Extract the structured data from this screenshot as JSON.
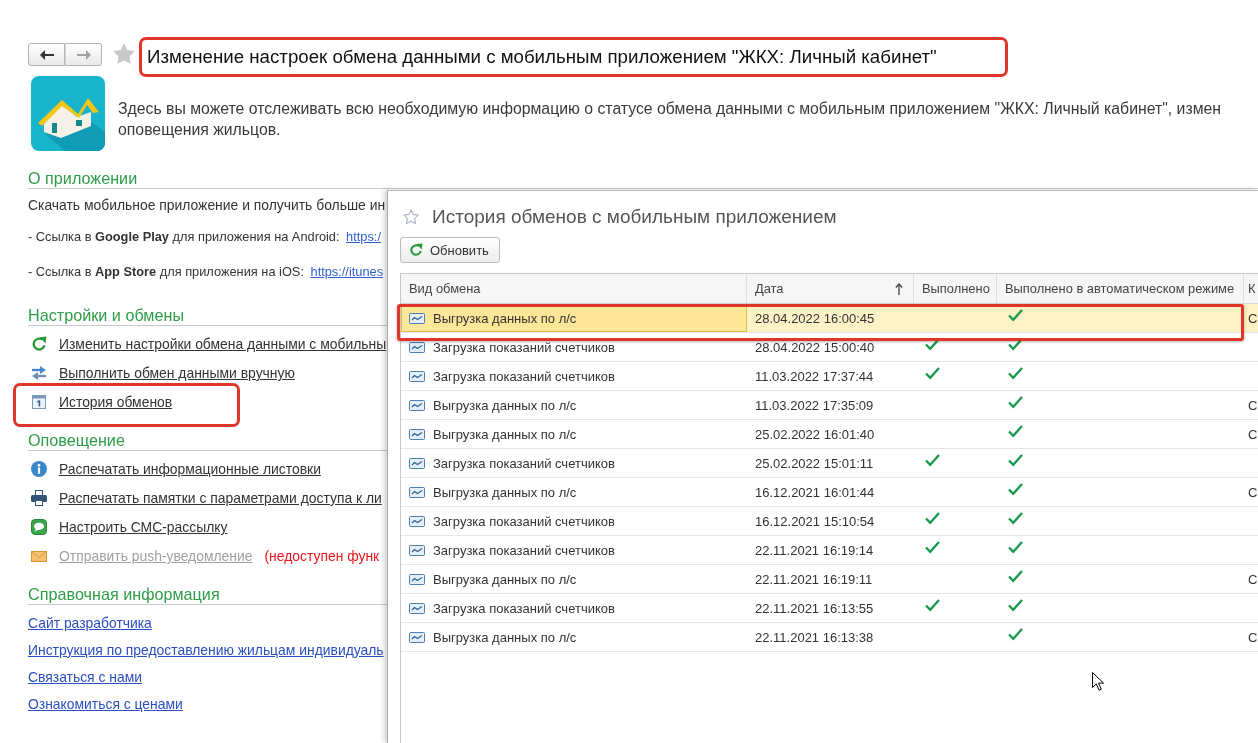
{
  "navigation": [
    {
      "kind": "back",
      "disabled": false
    },
    {
      "kind": "forward",
      "disabled": true
    }
  ],
  "header": {
    "title": "Изменение настроек обмена данными с мобильным приложением \"ЖКХ: Личный кабинет\"",
    "title_highlighted": true,
    "description_lines": [
      "Здесь вы можете отслеживать всю необходимую информацию о статусе обмена данными с мобильным приложением \"ЖКХ: Личный кабинет\", измен",
      "оповещения жильцов."
    ]
  },
  "sections": [
    {
      "heading": "О приложении",
      "items": [
        {
          "kind": "text",
          "text": "Скачать мобильное приложение и получить больше ин"
        },
        {
          "kind": "store_link",
          "text": "- Ссылка в **Google Play** для приложения на Android:",
          "url": "https:/"
        },
        {
          "kind": "store_link",
          "text": "- Ссылка в **App Store** для приложения на iOS:",
          "url": "https://itunes"
        }
      ]
    },
    {
      "heading": "Настройки и обмены",
      "items": [
        {
          "kind": "action",
          "text": "Изменить настройки обмена данными с мобильны",
          "disabled": false,
          "highlighted": false
        },
        {
          "kind": "action",
          "text": "Выполнить обмен данными вручную",
          "disabled": false,
          "highlighted": false
        },
        {
          "kind": "action",
          "text": "История обменов",
          "disabled": false,
          "highlighted": true
        }
      ]
    },
    {
      "heading": "Оповещение",
      "items": [
        {
          "kind": "action",
          "text": "Распечатать информационные листовки",
          "disabled": false,
          "highlighted": false
        },
        {
          "kind": "action",
          "text": "Распечатать памятки с параметрами доступа к ли",
          "disabled": false,
          "highlighted": false
        },
        {
          "kind": "action",
          "text": "Настроить СМС-рассылку",
          "disabled": false,
          "highlighted": false
        },
        {
          "kind": "action",
          "text": "Отправить push-уведомление",
          "disabled": true,
          "highlighted": false,
          "note": "(недоступен функ"
        }
      ]
    },
    {
      "heading": "Справочная информация",
      "items": [
        {
          "kind": "link",
          "text": "Сайт разработчика"
        },
        {
          "kind": "link",
          "text": "Инструкция по предоставлению жильцам индивидуаль"
        },
        {
          "kind": "link",
          "text": "Связаться с нами"
        },
        {
          "kind": "link",
          "text": "Ознакомиться с ценами"
        }
      ]
    }
  ],
  "dialog": {
    "title": "История обменов с мобильным приложением",
    "refresh_button": "Обновить",
    "table": {
      "columns": [
        {
          "label": "Вид обмена",
          "sorted": false
        },
        {
          "label": "Дата",
          "sorted": true
        },
        {
          "label": "Выполнено",
          "sorted": false
        },
        {
          "label": "Выполнено в автоматическом режиме",
          "sorted": false
        },
        {
          "label": "К",
          "sorted": false
        }
      ],
      "rows": [
        {
          "exchange_type": "Выгрузка данных по л/с",
          "date": "28.04.2022 16:00:45",
          "completed": false,
          "completed_automatically": true,
          "column_5": "С",
          "selected": true,
          "highlighted": true
        },
        {
          "exchange_type": "Загрузка показаний счетчиков",
          "date": "28.04.2022 15:00:40",
          "completed": true,
          "completed_automatically": true,
          "selected": false,
          "highlighted": false
        },
        {
          "exchange_type": "Загрузка показаний счетчиков",
          "date": "11.03.2022 17:37:44",
          "completed": true,
          "completed_automatically": true,
          "selected": false,
          "highlighted": false
        },
        {
          "exchange_type": "Выгрузка данных по л/с",
          "date": "11.03.2022 17:35:09",
          "completed": false,
          "completed_automatically": true,
          "column_5": "С",
          "selected": false,
          "highlighted": false
        },
        {
          "exchange_type": "Выгрузка данных по л/с",
          "date": "25.02.2022 16:01:40",
          "completed": false,
          "completed_automatically": true,
          "column_5": "С",
          "selected": false,
          "highlighted": false
        },
        {
          "exchange_type": "Загрузка показаний счетчиков",
          "date": "25.02.2022 15:01:11",
          "completed": true,
          "completed_automatically": true,
          "selected": false,
          "highlighted": false
        },
        {
          "exchange_type": "Выгрузка данных по л/с",
          "date": "16.12.2021 16:01:44",
          "completed": false,
          "completed_automatically": true,
          "column_5": "С",
          "selected": false,
          "highlighted": false
        },
        {
          "exchange_type": "Загрузка показаний счетчиков",
          "date": "16.12.2021 15:10:54",
          "completed": true,
          "completed_automatically": true,
          "selected": false,
          "highlighted": false
        },
        {
          "exchange_type": "Загрузка показаний счетчиков",
          "date": "22.11.2021 16:19:14",
          "completed": true,
          "completed_automatically": true,
          "selected": false,
          "highlighted": false
        },
        {
          "exchange_type": "Выгрузка данных по л/с",
          "date": "22.11.2021 16:19:11",
          "completed": false,
          "completed_automatically": true,
          "column_5": "С",
          "selected": false,
          "highlighted": false
        },
        {
          "exchange_type": "Загрузка показаний счетчиков",
          "date": "22.11.2021 16:13:55",
          "completed": true,
          "completed_automatically": true,
          "selected": false,
          "highlighted": false
        },
        {
          "exchange_type": "Выгрузка данных по л/с",
          "date": "22.11.2021 16:13:38",
          "completed": false,
          "completed_automatically": true,
          "column_5": "С",
          "selected": false,
          "highlighted": false
        }
      ]
    }
  }
}
